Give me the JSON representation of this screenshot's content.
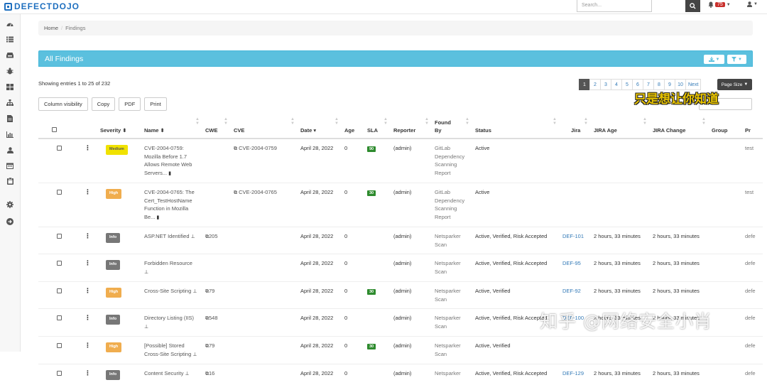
{
  "app": {
    "logo": "DEFECTDOJO"
  },
  "topbar": {
    "search_placeholder": "Search...",
    "notification_count": "75"
  },
  "breadcrumb": {
    "home": "Home",
    "current": "Findings"
  },
  "panel": {
    "title": "All Findings"
  },
  "table_info": {
    "showing": "Showing entries 1 to 25 of 232"
  },
  "pagination": {
    "pages": [
      "1",
      "2",
      "3",
      "4",
      "5",
      "6",
      "7",
      "8",
      "9",
      "10"
    ],
    "next": "Next",
    "page_size": "Page Size"
  },
  "toolbar": {
    "column_visibility": "Column visibility",
    "copy": "Copy",
    "pdf": "PDF",
    "print": "Print",
    "search_label": "Search:"
  },
  "overlay": {
    "text": "只是想让你知道"
  },
  "watermark": {
    "text": "知乎 @网络安全小肖"
  },
  "columns": {
    "severity": "Severity",
    "name": "Name",
    "cwe": "CWE",
    "cve": "CVE",
    "date": "Date",
    "age": "Age",
    "sla": "SLA",
    "reporter": "Reporter",
    "found_by": "Found By",
    "status": "Status",
    "jira": "Jira",
    "jira_age": "JIRA Age",
    "jira_change": "JIRA Change",
    "group": "Group",
    "product": "Pr"
  },
  "rows": [
    {
      "severity": "Medium",
      "sev_class": "medium",
      "name": "CVE-2004-0759: Mozilla Before 1.7 Allows Remote Web Servers...",
      "cwe": "",
      "cve": "CVE-2004-0759",
      "date": "April 28, 2022",
      "age": "0",
      "sla": "90",
      "reporter": "(admin)",
      "found_by": "GitLab Dependency Scanning Report",
      "status": "Active",
      "jira": "",
      "jira_age": "",
      "jira_change": "",
      "product": "test"
    },
    {
      "severity": "High",
      "sev_class": "high",
      "name": "CVE-2004-0765: The Cert_TestHostName Function in Mozilla Be...",
      "cwe": "",
      "cve": "CVE-2004-0765",
      "date": "April 28, 2022",
      "age": "0",
      "sla": "30",
      "reporter": "(admin)",
      "found_by": "GitLab Dependency Scanning Report",
      "status": "Active",
      "jira": "",
      "jira_age": "",
      "jira_change": "",
      "product": "test"
    },
    {
      "severity": "Info",
      "sev_class": "info",
      "name": "ASP.NET Identified",
      "cwe": "205",
      "cve": "",
      "date": "April 28, 2022",
      "age": "0",
      "sla": "",
      "reporter": "(admin)",
      "found_by": "Netsparker Scan",
      "status": "Active, Verified, Risk Accepted",
      "jira": "DEF-101",
      "jira_age": "2 hours, 33 minutes",
      "jira_change": "2 hours, 33 minutes",
      "product": "defe"
    },
    {
      "severity": "Info",
      "sev_class": "info",
      "name": "Forbidden Resource",
      "cwe": "",
      "cve": "",
      "date": "April 28, 2022",
      "age": "0",
      "sla": "",
      "reporter": "(admin)",
      "found_by": "Netsparker Scan",
      "status": "Active, Verified, Risk Accepted",
      "jira": "DEF-95",
      "jira_age": "2 hours, 33 minutes",
      "jira_change": "2 hours, 33 minutes",
      "product": "defe"
    },
    {
      "severity": "High",
      "sev_class": "high",
      "name": "Cross-Site Scripting",
      "cwe": "79",
      "cve": "",
      "date": "April 28, 2022",
      "age": "0",
      "sla": "30",
      "reporter": "(admin)",
      "found_by": "Netsparker Scan",
      "status": "Active, Verified",
      "jira": "DEF-92",
      "jira_age": "2 hours, 33 minutes",
      "jira_change": "2 hours, 33 minutes",
      "product": "defe"
    },
    {
      "severity": "Info",
      "sev_class": "info",
      "name": "Directory Listing (IIS)",
      "cwe": "548",
      "cve": "",
      "date": "April 28, 2022",
      "age": "0",
      "sla": "",
      "reporter": "(admin)",
      "found_by": "Netsparker Scan",
      "status": "Active, Verified, Risk Accepted",
      "jira": "DEF-100",
      "jira_age": "2 hours, 33 minutes",
      "jira_change": "2 hours, 33 minutes",
      "product": "defe"
    },
    {
      "severity": "High",
      "sev_class": "high",
      "name": "[Possible] Stored Cross-Site Scripting",
      "cwe": "79",
      "cve": "",
      "date": "April 28, 2022",
      "age": "0",
      "sla": "30",
      "reporter": "(admin)",
      "found_by": "Netsparker Scan",
      "status": "Active, Verified",
      "jira": "",
      "jira_age": "",
      "jira_change": "",
      "product": "defe"
    },
    {
      "severity": "Info",
      "sev_class": "info",
      "name": "Content Security",
      "cwe": "16",
      "cve": "",
      "date": "April 28, 2022",
      "age": "0",
      "sla": "",
      "reporter": "(admin)",
      "found_by": "Netsparker",
      "status": "Active, Verified, Risk Accepted",
      "jira": "DEF-129",
      "jira_age": "2 hours, 33 minutes",
      "jira_change": "2 hours, 33 minutes",
      "product": "defe"
    }
  ]
}
